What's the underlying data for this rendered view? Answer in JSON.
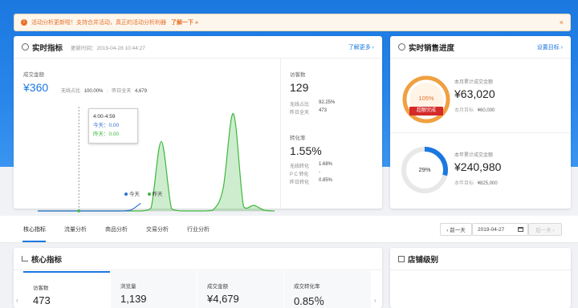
{
  "notice": {
    "text": "活动分析更新啦！支持合并活动，真正的活动分析利器",
    "link": "了解一下 »",
    "close": "×"
  },
  "realtime": {
    "title": "实时指标",
    "update_time": "更新时间：2019-04-28 10:44:27",
    "more": "了解更多 ›",
    "gmv_label": "成交金额",
    "gmv_value": "¥360",
    "wireless_ratio_label": "无线占比",
    "wireless_ratio": "100.00%",
    "yesterday_label": "昨日全天",
    "yesterday_value": "4,679",
    "tooltip": {
      "time": "4:00-4:59",
      "today": "今天：0.00",
      "yesterday": "昨天：0.00"
    },
    "legend": {
      "today": "今天",
      "yesterday": "昨天"
    },
    "visitors_label": "访客数",
    "visitors_value": "129",
    "v_wireless_label": "无线占比",
    "v_wireless": "92.25%",
    "v_yesterday_label": "昨日全天",
    "v_yesterday": "473",
    "conv_label": "转化率",
    "conv_value": "1.55%",
    "c_wireless_label": "无线转化",
    "c_wireless": "1.68%",
    "c_pc_label": "P C 转化",
    "c_pc": "-",
    "c_yesterday_label": "昨日转化",
    "c_yesterday": "0.85%"
  },
  "chart_data": {
    "type": "area",
    "x_ticks": [
      "0:00",
      "3:00",
      "6:00",
      "9:00",
      "12:00",
      "15:00",
      "18:00",
      "21:00"
    ],
    "series": [
      {
        "name": "今天",
        "color": "#2f6fd6",
        "x": [
          0,
          1,
          2,
          3,
          4,
          5,
          6,
          7,
          8,
          9,
          10
        ],
        "y": [
          0,
          0,
          0,
          0,
          0,
          0,
          0,
          0,
          0,
          5,
          55
        ]
      },
      {
        "name": "昨天",
        "color": "#3cb83c",
        "x": [
          0,
          1,
          2,
          3,
          4,
          5,
          6,
          7,
          8,
          9,
          10,
          11,
          12,
          13,
          14,
          15,
          16,
          17,
          18,
          19,
          20,
          21,
          22,
          23
        ],
        "y": [
          0,
          0,
          0,
          0,
          0,
          0,
          0,
          0,
          0,
          0,
          0,
          20,
          500,
          15,
          0,
          0,
          0,
          5,
          160,
          700,
          30,
          40,
          5,
          0
        ]
      }
    ]
  },
  "sales": {
    "title": "实时销售进度",
    "setting": "设置目标 ›",
    "month_percent": "105%",
    "month_badge": "超额完成",
    "month_label": "本月累计成交金额",
    "month_value": "¥63,020",
    "month_target_label": "本月目标",
    "month_target": "¥60,000",
    "year_percent": "29%",
    "year_label": "本年累计成交金额",
    "year_value": "¥240,980",
    "year_target_label": "本年目标",
    "year_target": "¥825,000"
  },
  "tabs": [
    "核心指标",
    "流量分析",
    "商品分析",
    "交易分析",
    "行业分析"
  ],
  "date": {
    "prev": "‹ 前一天",
    "value": "2019-04-27",
    "next": "后一天 ›"
  },
  "core": {
    "title": "核心指标",
    "metrics": [
      {
        "label": "访客数",
        "value": "473"
      },
      {
        "label": "浏览量",
        "value": "1,139"
      },
      {
        "label": "成交金额",
        "value": "¥4,679"
      },
      {
        "label": "成交转化率",
        "value": "0.85％"
      }
    ]
  },
  "shop": {
    "title": "店铺级别"
  }
}
